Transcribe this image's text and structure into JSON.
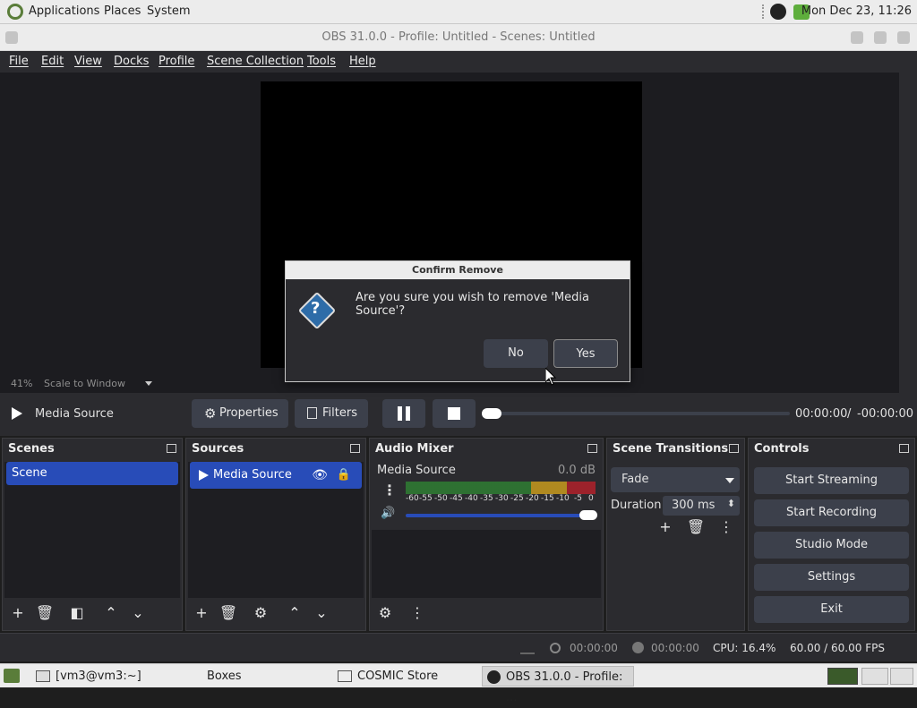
{
  "topbar": {
    "applications": "Applications",
    "places": "Places",
    "system": "System",
    "clock": "Mon Dec 23, 11:26"
  },
  "window": {
    "title": "OBS 31.0.0 - Profile: Untitled - Scenes: Untitled"
  },
  "menu": [
    "File",
    "Edit",
    "View",
    "Docks",
    "Profile",
    "Scene Collection",
    "Tools",
    "Help"
  ],
  "preview": {
    "zoom": "41%",
    "scale_mode": "Scale to Window"
  },
  "media_controls": {
    "source_name": "Media Source",
    "properties": "Properties",
    "filters": "Filters",
    "time_current": "00:00:00",
    "time_sep": "/",
    "time_remaining": "-00:00:00"
  },
  "scenes": {
    "title": "Scenes",
    "items": [
      "Scene"
    ]
  },
  "sources": {
    "title": "Sources",
    "items": [
      "Media Source"
    ]
  },
  "audio_mixer": {
    "title": "Audio Mixer",
    "channel_name": "Media Source",
    "db": "0.0 dB",
    "scale": [
      "-60",
      "-55",
      "-50",
      "-45",
      "-40",
      "-35",
      "-30",
      "-25",
      "-20",
      "-15",
      "-10",
      "-5",
      "0"
    ]
  },
  "transitions": {
    "title": "Scene Transitions",
    "selected": "Fade",
    "duration_label": "Duration",
    "duration_value": "300 ms"
  },
  "controls": {
    "title": "Controls",
    "buttons": [
      "Start Streaming",
      "Start Recording",
      "Studio Mode",
      "Settings",
      "Exit"
    ]
  },
  "status": {
    "stream_time": "00:00:00",
    "rec_time": "00:00:00",
    "cpu": "CPU: 16.4%",
    "fps": "60.00 / 60.00 FPS"
  },
  "dialog": {
    "title": "Confirm Remove",
    "message": "Are you sure you wish to remove 'Media Source'?",
    "no": "No",
    "yes": "Yes"
  },
  "taskbar": {
    "tasks": [
      "[vm3@vm3:~]",
      "Boxes",
      "COSMIC Store",
      "OBS 31.0.0 - Profile: ..."
    ]
  },
  "colors": {
    "accent": "#284cb8",
    "panel": "#2b2b2f",
    "button": "#3c404b"
  }
}
